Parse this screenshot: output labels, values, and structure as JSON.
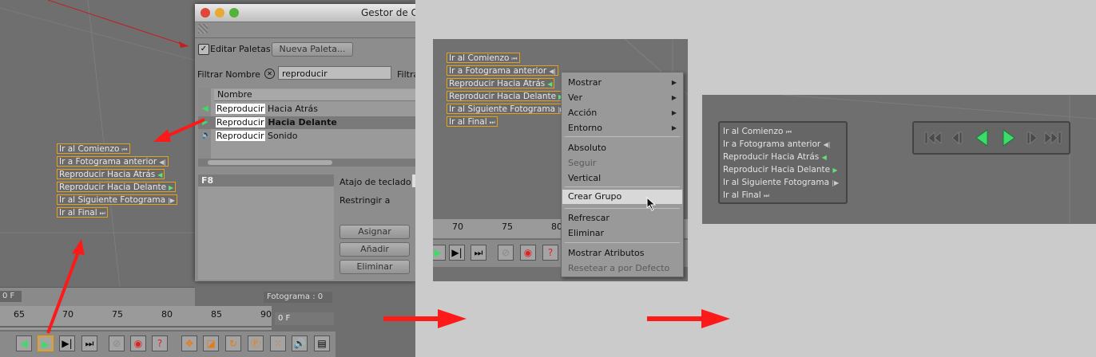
{
  "dialog": {
    "title": "Gestor de C",
    "edit_palettes": "Editar Paletas",
    "new_palette": "Nueva Paleta...",
    "filter_label": "Filtrar Nombre",
    "filter_value": "reproducir",
    "filter_label2": "Filtra",
    "column": "Nombre",
    "rows": [
      {
        "hl": "Reproducir",
        "rest": "Hacia Atrás"
      },
      {
        "hl": "Reproducir",
        "rest": "Hacia Delante"
      },
      {
        "hl": "Reproducir",
        "rest": "Sonido"
      }
    ],
    "shortcut_key": "F8",
    "shortcut_label": "Atajo de teclado",
    "restrict_label": "Restringir a",
    "assign": "Asignar",
    "add": "Añadir",
    "delete": "Eliminar"
  },
  "commands": [
    "Ir al Comienzo",
    "Ir a Fotograma anterior",
    "Reproducir Hacia Atrás",
    "Reproducir Hacia Delante",
    "Ir al Siguiente Fotograma",
    "Ir al Final"
  ],
  "timeline1": {
    "frame_left": "0 F",
    "frame_status": "Fotograma : 0",
    "ticks": [
      "65",
      "70",
      "75",
      "80",
      "85",
      "90"
    ],
    "frame_field": "0 F"
  },
  "timeline2": {
    "ticks": [
      "70",
      "75",
      "80"
    ]
  },
  "menu": {
    "items": [
      {
        "label": "Mostrar",
        "sub": true
      },
      {
        "label": "Ver",
        "sub": true
      },
      {
        "label": "Acción",
        "sub": true
      },
      {
        "label": "Entorno",
        "sub": true
      },
      {
        "label": "Absoluto"
      },
      {
        "label": "Seguir",
        "disabled": true
      },
      {
        "label": "Vertical"
      },
      {
        "label": "Crear Grupo",
        "selected": true
      },
      {
        "label": "Refrescar"
      },
      {
        "label": "Eliminar"
      },
      {
        "label": "Mostrar Atributos"
      },
      {
        "label": "Resetear a por Defecto",
        "disabled": true
      }
    ]
  },
  "colors": {
    "accent_outline": "#e7a01a",
    "arrow_red": "#ff1a1a",
    "play_green": "#3ddc6a"
  }
}
